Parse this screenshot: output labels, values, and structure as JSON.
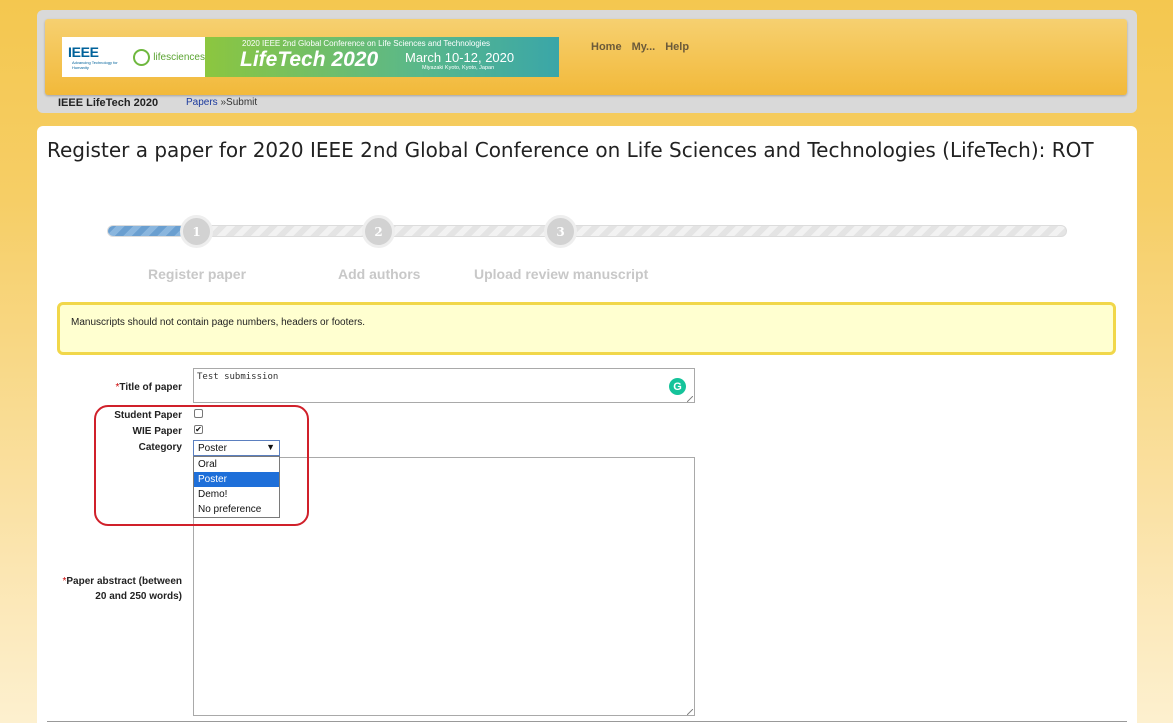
{
  "header": {
    "banner": {
      "ieee_logo": "IEEE",
      "ieee_tagline": "Advancing Technology for Humanity",
      "ls_logo": "lifesciences",
      "conference_line": "2020 IEEE 2nd Global Conference on Life Sciences and Technologies",
      "event_name": "LifeTech 2020",
      "event_dates": "March 10-12, 2020",
      "venue": "Miyazaki Kyoto, Kyoto, Japan"
    },
    "nav": [
      "Home",
      "My...",
      "Help"
    ],
    "site_name": "IEEE LifeTech 2020",
    "breadcrumb": {
      "link": "Papers",
      "separator": " »",
      "current": "Submit"
    }
  },
  "page_title": "Register a paper for 2020 IEEE 2nd Global Conference on Life Sciences and Technologies (LifeTech): ROT",
  "steps": [
    {
      "number": "1",
      "label": "Register paper"
    },
    {
      "number": "2",
      "label": "Add authors"
    },
    {
      "number": "3",
      "label": "Upload review manuscript"
    }
  ],
  "progress_fraction": 0.08,
  "notice": "Manuscripts should not contain page numbers, headers or footers.",
  "form": {
    "required_mark": "*",
    "title_label": "Title of paper",
    "title_value": "Test submission",
    "student_label": "Student Paper",
    "student_checked": false,
    "wie_label": "WIE Paper",
    "wie_checked": true,
    "category_label": "Category",
    "category_value": "Poster",
    "category_options": [
      "Oral",
      "Poster",
      "Demo!",
      "No preference"
    ],
    "category_selected_index": 1,
    "abstract_label": "Paper abstract (between 20 and 250 words)",
    "abstract_value": ""
  },
  "icons": {
    "grammarly": "grammarly-icon",
    "dropdown_arrow": "▼",
    "checkmark": "✔"
  },
  "colors": {
    "highlight_ring": "#d0202a",
    "selected_option": "#1e6fd9",
    "notice_border": "#f1d74a"
  }
}
